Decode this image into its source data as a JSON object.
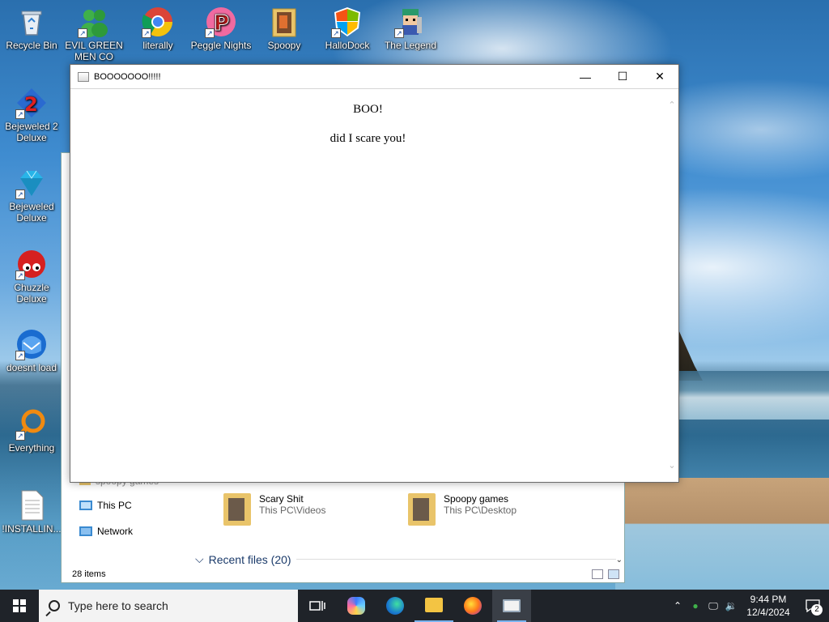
{
  "desktop": {
    "icons": [
      {
        "label": "Recycle Bin",
        "icon": "recycle-bin-icon"
      },
      {
        "label": "EVIL GREEN MEN CO",
        "icon": "green-people-icon"
      },
      {
        "label": "literally",
        "icon": "chrome-icon"
      },
      {
        "label": "Peggle Nights",
        "icon": "peggle-icon"
      },
      {
        "label": "Spoopy",
        "icon": "folder-icon"
      },
      {
        "label": "HalloDock",
        "icon": "windows-shield-icon"
      },
      {
        "label": "The Legend",
        "icon": "pixel-hero-icon"
      },
      {
        "label": "Bejeweled 2 Deluxe",
        "icon": "bejeweled2-icon"
      },
      {
        "label": "Bejeweled Deluxe",
        "icon": "diamond-icon"
      },
      {
        "label": "Chuzzle Deluxe",
        "icon": "chuzzle-icon"
      },
      {
        "label": "doesnt load",
        "icon": "thunderbird-icon"
      },
      {
        "label": "Everything",
        "icon": "magnifier-icon"
      },
      {
        "label": "!INSTALLIN...",
        "icon": "text-file-icon"
      }
    ]
  },
  "explorer": {
    "nav": {
      "partial": "spoopy games",
      "this_pc": "This PC",
      "network": "Network"
    },
    "quick_access": [
      {
        "name": "Scary Shit",
        "path": "This PC\\Videos"
      },
      {
        "name": "Spoopy games",
        "path": "This PC\\Desktop"
      }
    ],
    "recent_files": "Recent files (20)",
    "status": "28 items"
  },
  "boo_window": {
    "title": "BOOOOOOO!!!!!",
    "heading": "BOO!",
    "body": "did I scare you!",
    "minimize": "—",
    "maximize": "☐",
    "close": "✕"
  },
  "taskbar": {
    "search_placeholder": "Type here to search",
    "apps": [
      "task-view-icon",
      "copilot-icon",
      "edge-icon",
      "file-explorer-icon",
      "firefox-icon",
      "boo-app-icon"
    ],
    "tray": {
      "time": "9:44 PM",
      "date": "12/4/2024",
      "notifications": "2"
    }
  },
  "colors": {
    "taskbar": "#1f2329",
    "search_bg": "#f3f3f3",
    "accent": "#7ab4f0"
  }
}
